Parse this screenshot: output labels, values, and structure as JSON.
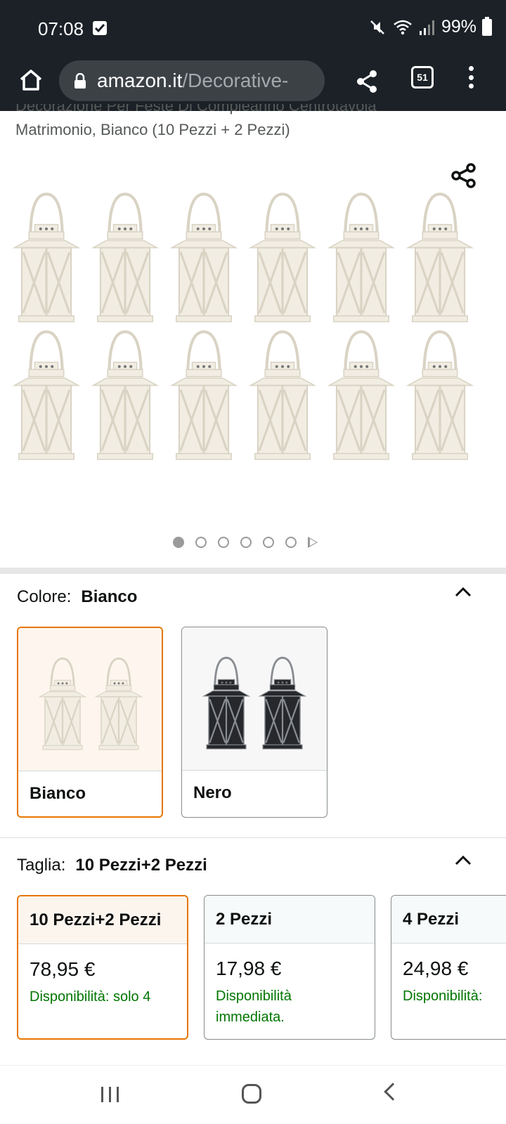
{
  "status_bar": {
    "time": "07:08",
    "battery": "99%"
  },
  "browser": {
    "url_domain": "amazon.it",
    "url_path": "/Decorative-",
    "tab_count": "51"
  },
  "product": {
    "title_line1": "Decorazione Per Feste Di Compleanno Centrotavola",
    "title_line2": "Matrimonio, Bianco (10 Pezzi + 2 Pezzi)"
  },
  "gallery": {
    "page_count": 6,
    "active_index": 0
  },
  "color_section": {
    "label": "Colore:",
    "selected": "Bianco",
    "options": [
      {
        "label": "Bianco",
        "lantern_color": "#f1ede2"
      },
      {
        "label": "Nero",
        "lantern_color": "#26282c"
      }
    ]
  },
  "size_section": {
    "label": "Taglia:",
    "selected": "10 Pezzi+2 Pezzi",
    "options": [
      {
        "label": "10 Pezzi+2 Pezzi",
        "price": "78,95 €",
        "availability": "Disponibilità: solo 4"
      },
      {
        "label": "2 Pezzi",
        "price": "17,98 €",
        "availability": "Disponibilità immediata."
      },
      {
        "label": "4 Pezzi",
        "price": "24,98 €",
        "availability": "Disponibilità:"
      }
    ]
  },
  "colors": {
    "status_bg": "#1b2127",
    "selected_border": "#e77600",
    "availability_green": "#007600"
  }
}
